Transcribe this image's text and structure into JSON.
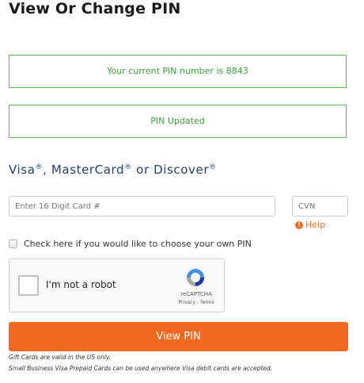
{
  "page": {
    "title": "View Or Change PIN"
  },
  "alerts": {
    "current_pin": "Your current PIN number is 8843",
    "updated": "PIN Updated"
  },
  "cards_heading": {
    "visa": "Visa",
    "sep1": ", MasterCard",
    "sep2": " or Discover",
    "registered": "®"
  },
  "form": {
    "card_number_placeholder": "Enter 16 Digit Card #",
    "cvn_placeholder": "CVN",
    "help_label": "Help",
    "help_icon": "info-icon",
    "own_pin_label": "Check here if you would like to choose your own PIN"
  },
  "recaptcha": {
    "label": "I'm not a robot",
    "brand": "reCAPTCHA",
    "links": "Privacy - Terms"
  },
  "button": {
    "view_pin": "View PIN"
  },
  "notes": {
    "gift_cards": "Gift Cards are valid in the US only.",
    "small_business": "Small Business Visa Prepaid Cards can be used anywhere Visa debit cards are accepted."
  },
  "colors": {
    "accent": "#f26a21",
    "alert_border": "#5cb85c",
    "alert_text": "#3c9a3c",
    "heading": "#1f3e6b"
  }
}
